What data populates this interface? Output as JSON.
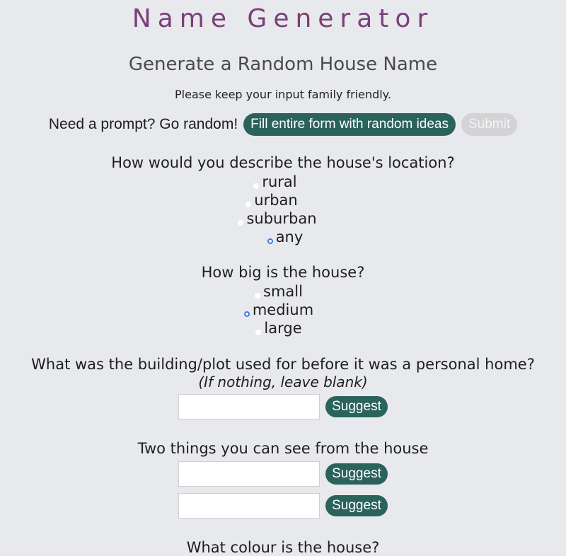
{
  "header": {
    "title": "Name Generator",
    "subtitle": "Generate a Random House Name",
    "note": "Please keep your input family friendly."
  },
  "random": {
    "label": "Need a prompt? Go random!",
    "fill_button": "Fill entire form with random ideas",
    "submit_button": "Submit"
  },
  "location": {
    "question": "How would you describe the house's location?",
    "options": [
      "rural",
      "urban",
      "suburban",
      "any"
    ],
    "selected": "any"
  },
  "size": {
    "question": "How big is the house?",
    "options": [
      "small",
      "medium",
      "large"
    ],
    "selected": "medium"
  },
  "previous_use": {
    "question": "What was the building/plot used for before it was a personal home?",
    "hint": "(If nothing, leave blank)",
    "value": "",
    "suggest_label": "Suggest"
  },
  "views": {
    "question": "Two things you can see from the house",
    "inputs": [
      {
        "value": "",
        "suggest_label": "Suggest"
      },
      {
        "value": "",
        "suggest_label": "Suggest"
      }
    ]
  },
  "colour": {
    "question": "What colour is the house?"
  }
}
